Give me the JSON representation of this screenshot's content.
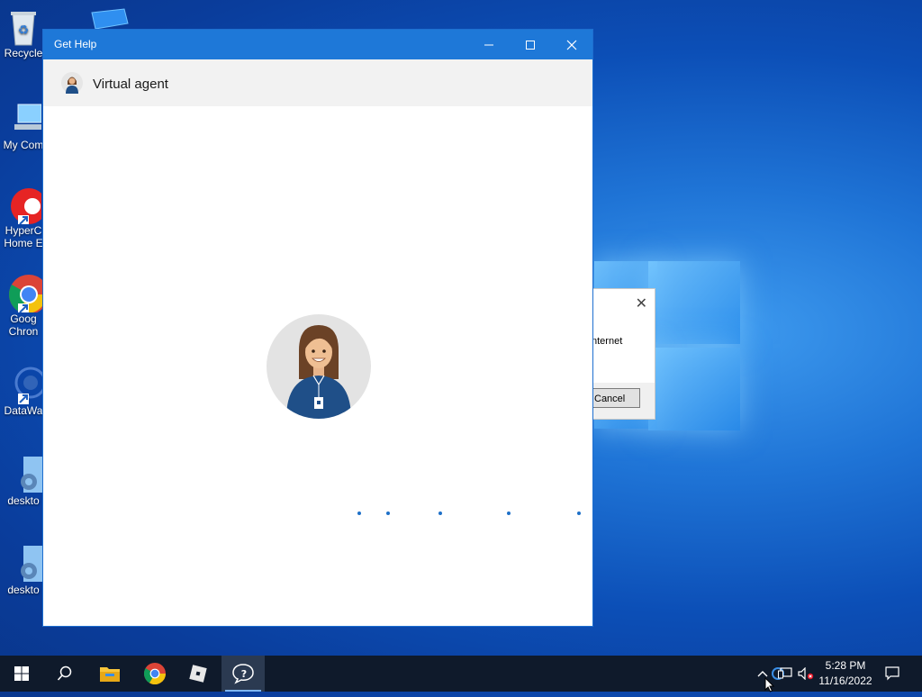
{
  "desktop": {
    "icons": [
      {
        "label": "Recycle",
        "icon": "recycle-bin-icon"
      },
      {
        "label": "My Com",
        "icon": "computer-icon"
      },
      {
        "label_line1": "HyperC",
        "label_line2": "Home E",
        "icon": "hypercam-icon"
      },
      {
        "label_line1": "Goog",
        "label_line2": "Chron",
        "icon": "chrome-icon"
      },
      {
        "label": "DataWa",
        "icon": "datawagon-icon"
      },
      {
        "label": "deskto",
        "icon": "desktop-file-icon"
      },
      {
        "label": "deskto",
        "icon": "desktop-file-icon"
      }
    ]
  },
  "background_dialog": {
    "text": "nternet",
    "cancel_label": "Cancel"
  },
  "window": {
    "title": "Get Help",
    "agent_name": "Virtual agent",
    "controls": [
      "minimize-icon",
      "maximize-icon",
      "close-icon"
    ]
  },
  "taskbar": {
    "apps": [
      "start-icon",
      "search-icon",
      "file-explorer-icon",
      "chrome-icon",
      "roblox-icon",
      "get-help-icon"
    ],
    "active_app": "get-help-icon"
  },
  "tray": {
    "time": "5:28 PM",
    "date": "11/16/2022"
  },
  "colors": {
    "title_bar": "#1e78d8",
    "header_bg": "#f2f2f2",
    "taskbar": "#0f1a2b",
    "dot": "#1e70c8"
  }
}
